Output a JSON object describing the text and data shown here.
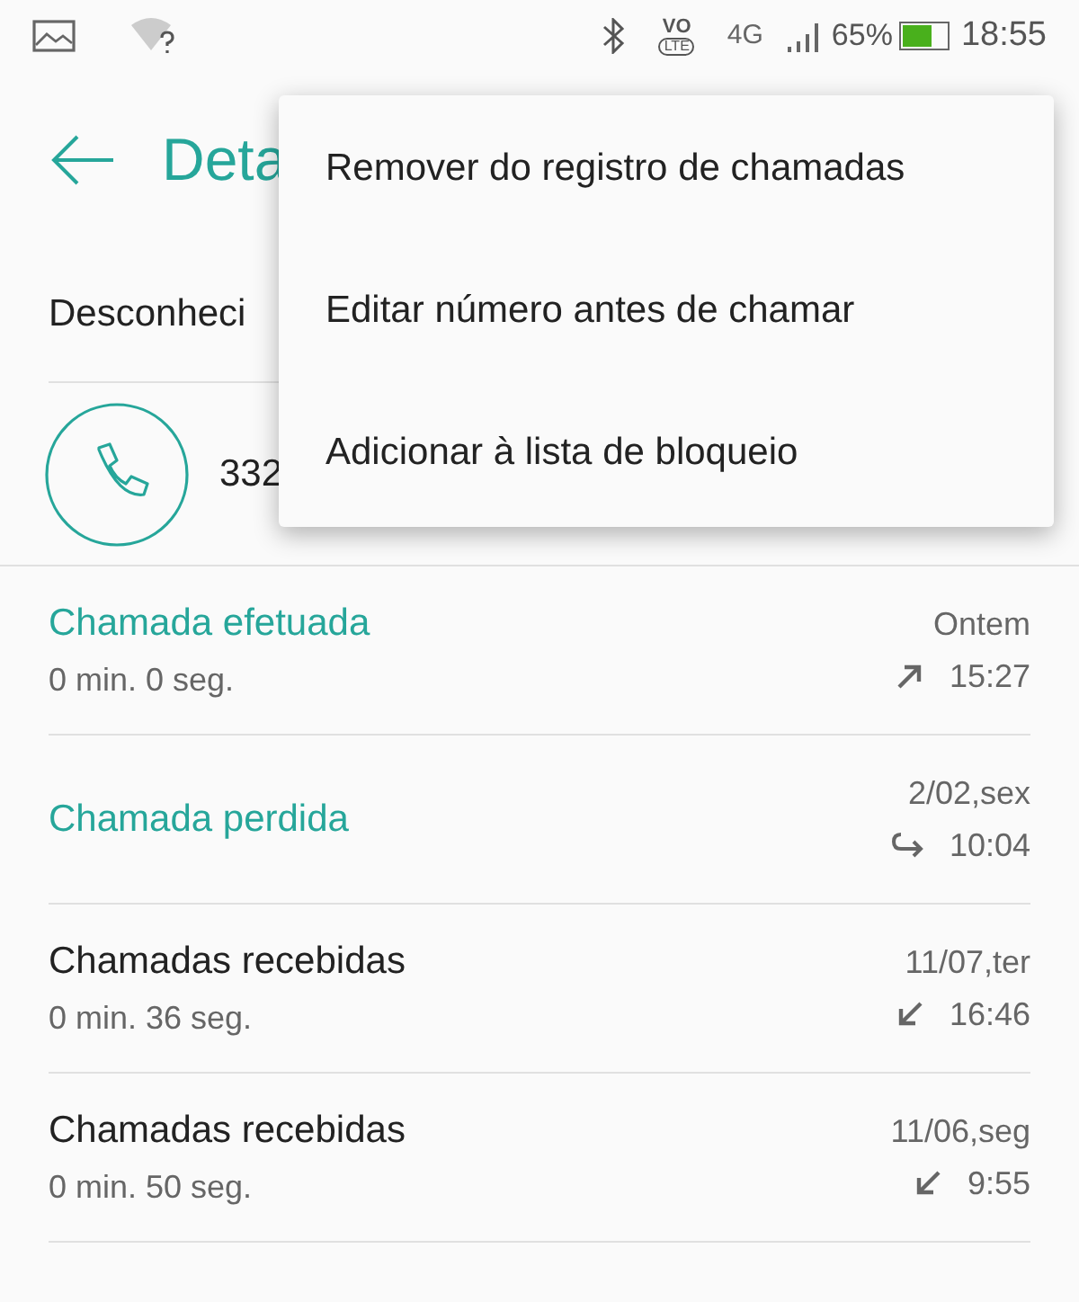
{
  "status_bar": {
    "volte": [
      "VO",
      "LTE"
    ],
    "network": "4G",
    "battery": "65%",
    "time": "18:55"
  },
  "header": {
    "title": "Deta"
  },
  "contact": {
    "name": "Desconheci",
    "number": "332"
  },
  "menu": [
    {
      "label": "Remover do registro de chamadas"
    },
    {
      "label": "Editar número antes de chamar"
    },
    {
      "label": "Adicionar à lista de bloqueio"
    }
  ],
  "calls": [
    {
      "kind": "outgoing",
      "title": "Chamada efetuada",
      "duration": "0 min. 0 seg.",
      "date": "Ontem",
      "time": "15:27"
    },
    {
      "kind": "missed",
      "title": "Chamada perdida",
      "date": "2/02,sex",
      "time": "10:04"
    },
    {
      "kind": "incoming",
      "title": "Chamadas recebidas",
      "duration": "0 min. 36 seg.",
      "date": "11/07,ter",
      "time": "16:46"
    },
    {
      "kind": "incoming",
      "title": "Chamadas recebidas",
      "duration": "0 min. 50 seg.",
      "date": "11/06,seg",
      "time": "9:55"
    }
  ]
}
